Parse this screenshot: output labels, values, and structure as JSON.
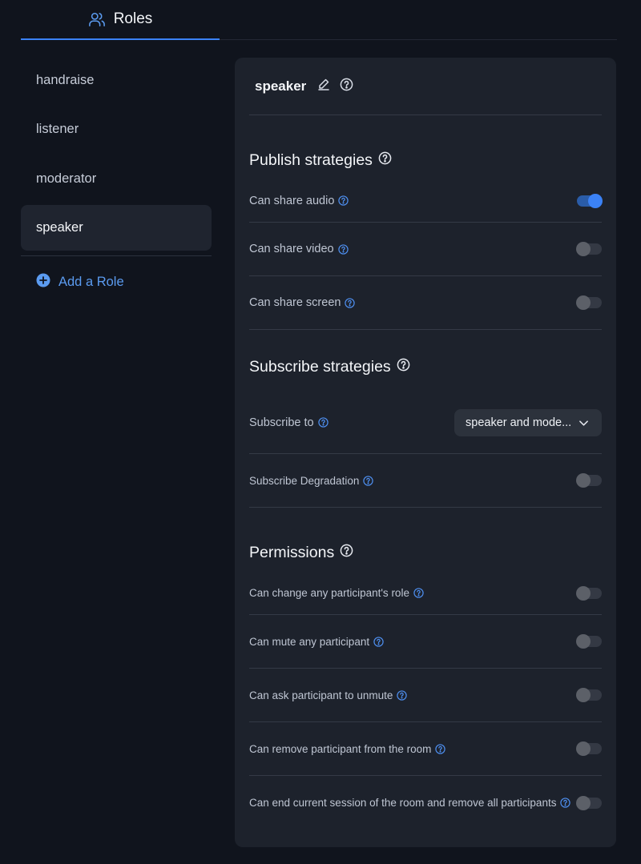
{
  "tabs": [
    {
      "label": "Roles",
      "icon": "users-icon",
      "active": true
    }
  ],
  "roles": [
    {
      "name": "handraise",
      "active": false
    },
    {
      "name": "listener",
      "active": false
    },
    {
      "name": "moderator",
      "active": false
    },
    {
      "name": "speaker",
      "active": true
    }
  ],
  "add_role_label": "Add a Role",
  "panel": {
    "role_name": "speaker",
    "publish": {
      "title": "Publish strategies",
      "items": [
        {
          "label": "Can share audio",
          "enabled": true
        },
        {
          "label": "Can share video",
          "enabled": false
        },
        {
          "label": "Can share screen",
          "enabled": false
        }
      ]
    },
    "subscribe": {
      "title": "Subscribe strategies",
      "subscribe_to_label": "Subscribe to",
      "subscribe_to_value": "speaker and mode...",
      "degradation_label": "Subscribe Degradation",
      "degradation_enabled": false
    },
    "permissions": {
      "title": "Permissions",
      "items": [
        {
          "label": "Can change any participant's role",
          "enabled": false
        },
        {
          "label": "Can mute any participant",
          "enabled": false
        },
        {
          "label": "Can ask participant to unmute",
          "enabled": false
        },
        {
          "label": "Can remove participant from the room",
          "enabled": false
        },
        {
          "label": "Can end current session of the room and remove all participants",
          "enabled": false
        }
      ]
    }
  },
  "colors": {
    "accent": "#3b82f6",
    "background": "#10141d",
    "panel": "#1d222c"
  }
}
